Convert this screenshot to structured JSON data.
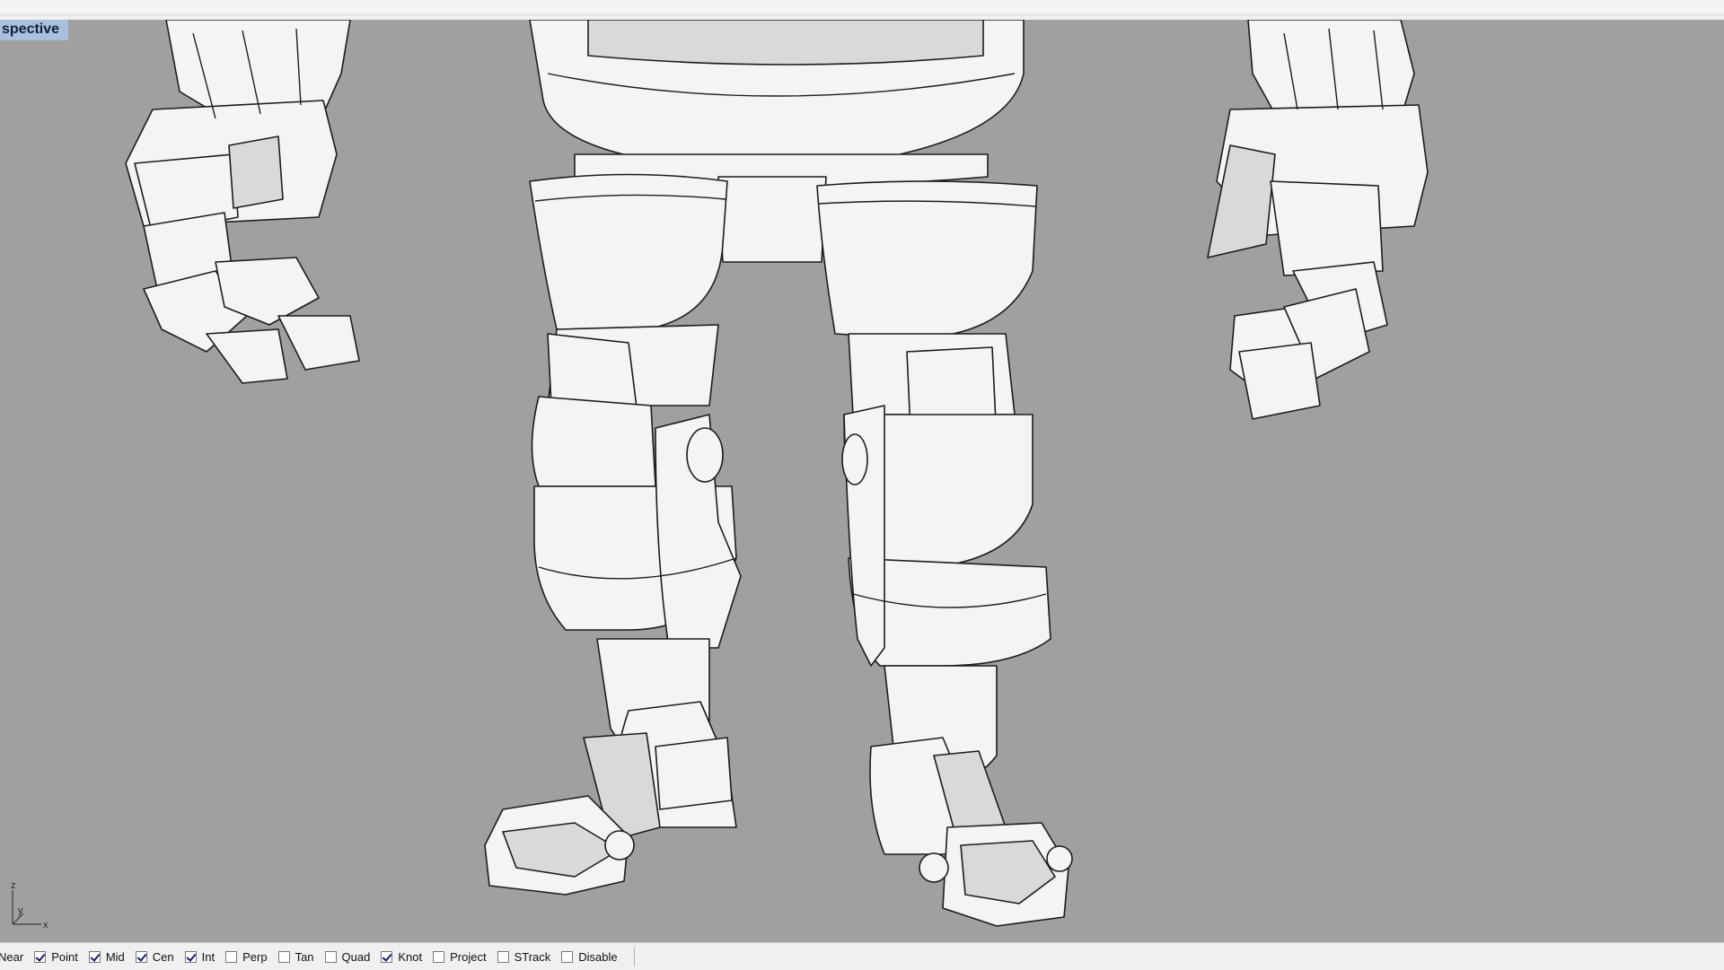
{
  "viewport": {
    "title": "spective"
  },
  "axes": {
    "z": "z",
    "y": "y",
    "x": "x"
  },
  "osnap": {
    "items": [
      {
        "label": "Near",
        "checked": true,
        "has_checkbox": false
      },
      {
        "label": "Point",
        "checked": true,
        "has_checkbox": true
      },
      {
        "label": "Mid",
        "checked": true,
        "has_checkbox": true
      },
      {
        "label": "Cen",
        "checked": true,
        "has_checkbox": true
      },
      {
        "label": "Int",
        "checked": true,
        "has_checkbox": true
      },
      {
        "label": "Perp",
        "checked": false,
        "has_checkbox": true
      },
      {
        "label": "Tan",
        "checked": false,
        "has_checkbox": true
      },
      {
        "label": "Quad",
        "checked": false,
        "has_checkbox": true
      },
      {
        "label": "Knot",
        "checked": true,
        "has_checkbox": true
      },
      {
        "label": "Project",
        "checked": false,
        "has_checkbox": true
      },
      {
        "label": "STrack",
        "checked": false,
        "has_checkbox": true
      },
      {
        "label": "Disable",
        "checked": false,
        "has_checkbox": true
      }
    ]
  },
  "colors": {
    "viewport_bg": "#a0a0a0",
    "title_bg": "#a9c0dc",
    "model_fill": "#f4f4f4",
    "edge": "#1c1c1c"
  }
}
